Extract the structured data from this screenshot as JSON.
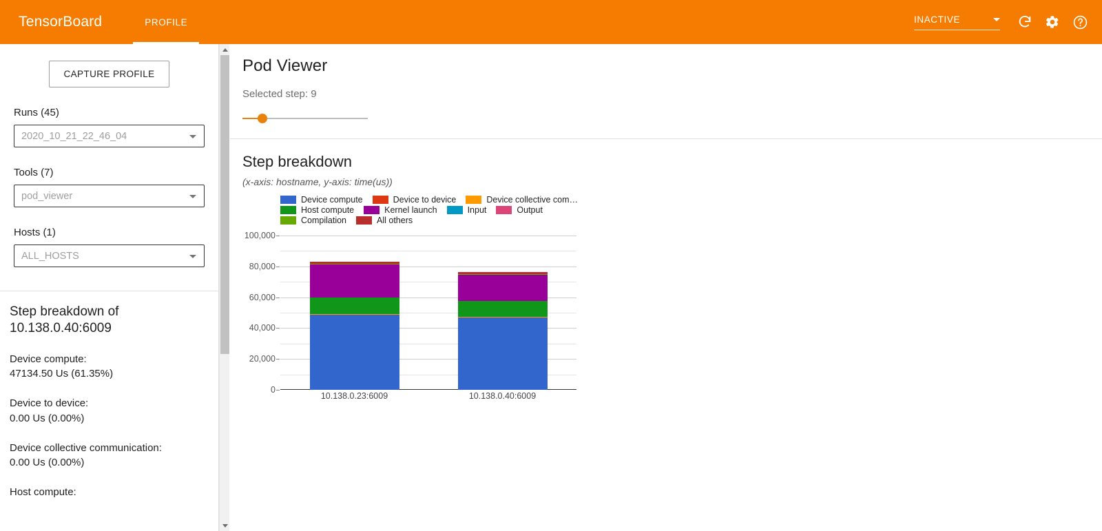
{
  "topbar": {
    "brand": "TensorBoard",
    "tabs": [
      {
        "label": "PROFILE",
        "active": true
      }
    ],
    "status": {
      "value": "INACTIVE"
    },
    "icons": {
      "reload": "reload-icon",
      "settings": "gear-icon",
      "help": "help-icon"
    }
  },
  "sidebar": {
    "capture_button": "CAPTURE PROFILE",
    "runs": {
      "label": "Runs (45)",
      "value": "2020_10_21_22_46_04"
    },
    "tools": {
      "label": "Tools (7)",
      "value": "pod_viewer"
    },
    "hosts": {
      "label": "Hosts (1)",
      "value": "ALL_HOSTS"
    },
    "breakdown": {
      "title": "Step breakdown of 10.138.0.40:6009",
      "items": [
        {
          "key": "Device compute:",
          "value": "47134.50 Us (61.35%)"
        },
        {
          "key": "Device to device:",
          "value": "0.00 Us (0.00%)"
        },
        {
          "key": "Device collective communication:",
          "value": "0.00 Us (0.00%)"
        },
        {
          "key": "Host compute:",
          "value": ""
        }
      ]
    }
  },
  "main": {
    "page_title": "Pod Viewer",
    "selected_step": "Selected step: 9",
    "slider": {
      "percent": 16
    }
  },
  "chart_data": {
    "type": "bar",
    "title": "Step breakdown",
    "subtitle": "(x-axis: hostname, y-axis: time(us))",
    "xlabel": "hostname",
    "ylabel": "time(us)",
    "stacked": true,
    "grid": true,
    "legend_position": "top",
    "ylim": [
      0,
      100000
    ],
    "yticks": [
      0,
      20000,
      40000,
      60000,
      80000,
      100000
    ],
    "ytick_labels": [
      "0",
      "20,000",
      "40,000",
      "60,000",
      "80,000",
      "100,000"
    ],
    "minor_gridlines": [
      10000,
      30000,
      50000,
      70000,
      90000
    ],
    "categories": [
      "10.138.0.23:6009",
      "10.138.0.40:6009"
    ],
    "series": [
      {
        "name": "Device compute",
        "color": "#3366cc",
        "values": [
          48500,
          47134.5
        ]
      },
      {
        "name": "Device to device",
        "color": "#dc3912",
        "values": [
          0,
          0
        ]
      },
      {
        "name": "Device collective com…",
        "color": "#ff9900",
        "values": [
          450,
          400
        ]
      },
      {
        "name": "Host compute",
        "color": "#109618",
        "values": [
          11000,
          10200
        ]
      },
      {
        "name": "Kernel launch",
        "color": "#990099",
        "values": [
          21500,
          17200
        ]
      },
      {
        "name": "Input",
        "color": "#0099c6",
        "values": [
          0,
          0
        ]
      },
      {
        "name": "Output",
        "color": "#dd4477",
        "values": [
          0,
          0
        ]
      },
      {
        "name": "Compilation",
        "color": "#66aa00",
        "values": [
          300,
          250
        ]
      },
      {
        "name": "All others",
        "color": "#b82e2e",
        "values": [
          1250,
          1050
        ]
      }
    ],
    "totals": [
      83000,
      76234.5
    ]
  }
}
